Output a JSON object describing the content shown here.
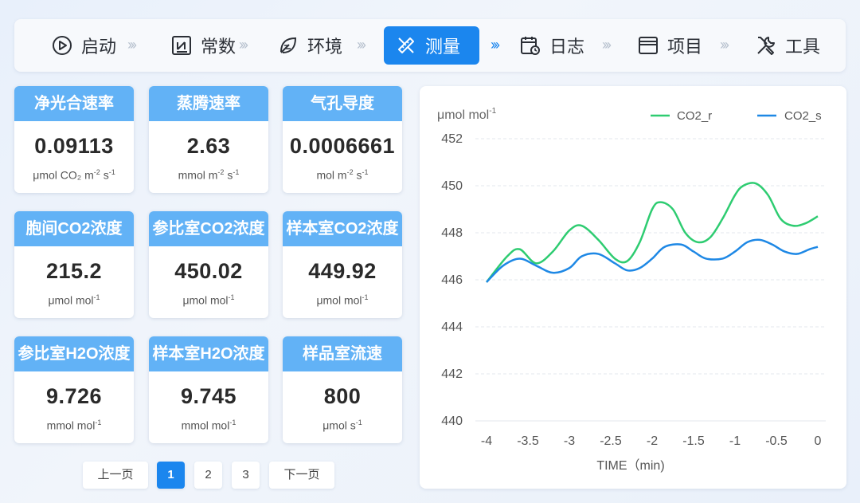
{
  "nav": {
    "steps": [
      {
        "label": "启动",
        "icon": "play-circle-icon"
      },
      {
        "label": "常数",
        "icon": "constant-box-icon"
      },
      {
        "label": "环境",
        "icon": "leaf-environment-icon"
      },
      {
        "label": "测量",
        "icon": "measure-tools-icon",
        "active": true
      },
      {
        "label": "日志",
        "icon": "calendar-log-icon"
      },
      {
        "label": "项目",
        "icon": "window-project-icon"
      },
      {
        "label": "工具",
        "icon": "wrench-tools-icon"
      }
    ],
    "arrow": "›››"
  },
  "cards": [
    {
      "title": "净光合速率",
      "value": "0.09113",
      "unit_pre": "μmol CO₂ m",
      "unit_parts": [
        {
          "t": "μmol CO₂ m"
        },
        {
          "s": "-2"
        },
        {
          "t": " s"
        },
        {
          "s": "-1"
        }
      ]
    },
    {
      "title": "蒸腾速率",
      "value": "2.63",
      "unit_parts": [
        {
          "t": "mmol m"
        },
        {
          "s": "-2"
        },
        {
          "t": " s"
        },
        {
          "s": "-1"
        }
      ]
    },
    {
      "title": "气孔导度",
      "value": "0.0006661",
      "unit_parts": [
        {
          "t": "mol m"
        },
        {
          "s": "-2"
        },
        {
          "t": " s"
        },
        {
          "s": "-1"
        }
      ]
    },
    {
      "title": "胞间CO2浓度",
      "value": "215.2",
      "unit_parts": [
        {
          "t": "μmol mol"
        },
        {
          "s": "-1"
        }
      ]
    },
    {
      "title": "参比室CO2浓度",
      "value": "450.02",
      "unit_parts": [
        {
          "t": "μmol mol"
        },
        {
          "s": "-1"
        }
      ]
    },
    {
      "title": "样本室CO2浓度",
      "value": "449.92",
      "unit_parts": [
        {
          "t": "μmol mol"
        },
        {
          "s": "-1"
        }
      ]
    },
    {
      "title": "参比室H2O浓度",
      "value": "9.726",
      "unit_parts": [
        {
          "t": "mmol mol"
        },
        {
          "s": "-1"
        }
      ]
    },
    {
      "title": "样本室H2O浓度",
      "value": "9.745",
      "unit_parts": [
        {
          "t": "mmol mol"
        },
        {
          "s": "-1"
        }
      ]
    },
    {
      "title": "样品室流速",
      "value": "800",
      "unit_parts": [
        {
          "t": "μmol s"
        },
        {
          "s": "-1"
        }
      ]
    }
  ],
  "pager": {
    "prev": "上一页",
    "pages": [
      "1",
      "2",
      "3"
    ],
    "current": "1",
    "next": "下一页"
  },
  "colors": {
    "accent": "#1b86ee",
    "card_header": "#62b2f6",
    "series_r": "#2ecc71",
    "series_s": "#1e88e5"
  },
  "chart_data": {
    "type": "line",
    "ylabel_main": "μmol  mol",
    "ylabel_sup": "-1",
    "xlabel": "TIME（min)",
    "xlim": [
      -4,
      0
    ],
    "ylim": [
      440,
      452
    ],
    "xticks": [
      "-4",
      "-3.5",
      "-3",
      "-2.5",
      "-2",
      "-1.5",
      "-1",
      "-0.5",
      "0"
    ],
    "yticks": [
      "452",
      "450",
      "448",
      "446",
      "444",
      "442",
      "440"
    ],
    "grid": true,
    "legend_position": "top-right",
    "series": [
      {
        "name": "CO2_r",
        "color": "#2ecc71",
        "x": [
          -4,
          -3.75,
          -3.6,
          -3.4,
          -3.2,
          -3.0,
          -2.85,
          -2.65,
          -2.45,
          -2.3,
          -2.15,
          -2.0,
          -1.9,
          -1.75,
          -1.6,
          -1.45,
          -1.3,
          -1.15,
          -1.0,
          -0.9,
          -0.75,
          -0.6,
          -0.45,
          -0.3,
          -0.15,
          0.0
        ],
        "y": [
          445.9,
          447.0,
          447.3,
          446.7,
          447.2,
          448.1,
          448.3,
          447.7,
          446.9,
          446.8,
          447.6,
          449.0,
          449.3,
          449.0,
          448.0,
          447.6,
          447.8,
          448.6,
          449.6,
          450.0,
          450.1,
          449.6,
          448.6,
          448.3,
          448.4,
          448.7
        ]
      },
      {
        "name": "CO2_s",
        "color": "#1e88e5",
        "x": [
          -4,
          -3.8,
          -3.6,
          -3.4,
          -3.2,
          -3.0,
          -2.85,
          -2.65,
          -2.45,
          -2.3,
          -2.15,
          -2.0,
          -1.85,
          -1.65,
          -1.5,
          -1.35,
          -1.15,
          -1.0,
          -0.85,
          -0.7,
          -0.55,
          -0.4,
          -0.25,
          -0.1,
          0.0
        ],
        "y": [
          445.9,
          446.6,
          446.9,
          446.6,
          446.3,
          446.5,
          447.0,
          447.1,
          446.7,
          446.4,
          446.5,
          446.9,
          447.4,
          447.5,
          447.2,
          446.9,
          446.9,
          447.2,
          447.6,
          447.7,
          447.5,
          447.2,
          447.1,
          447.3,
          447.4
        ]
      }
    ]
  }
}
